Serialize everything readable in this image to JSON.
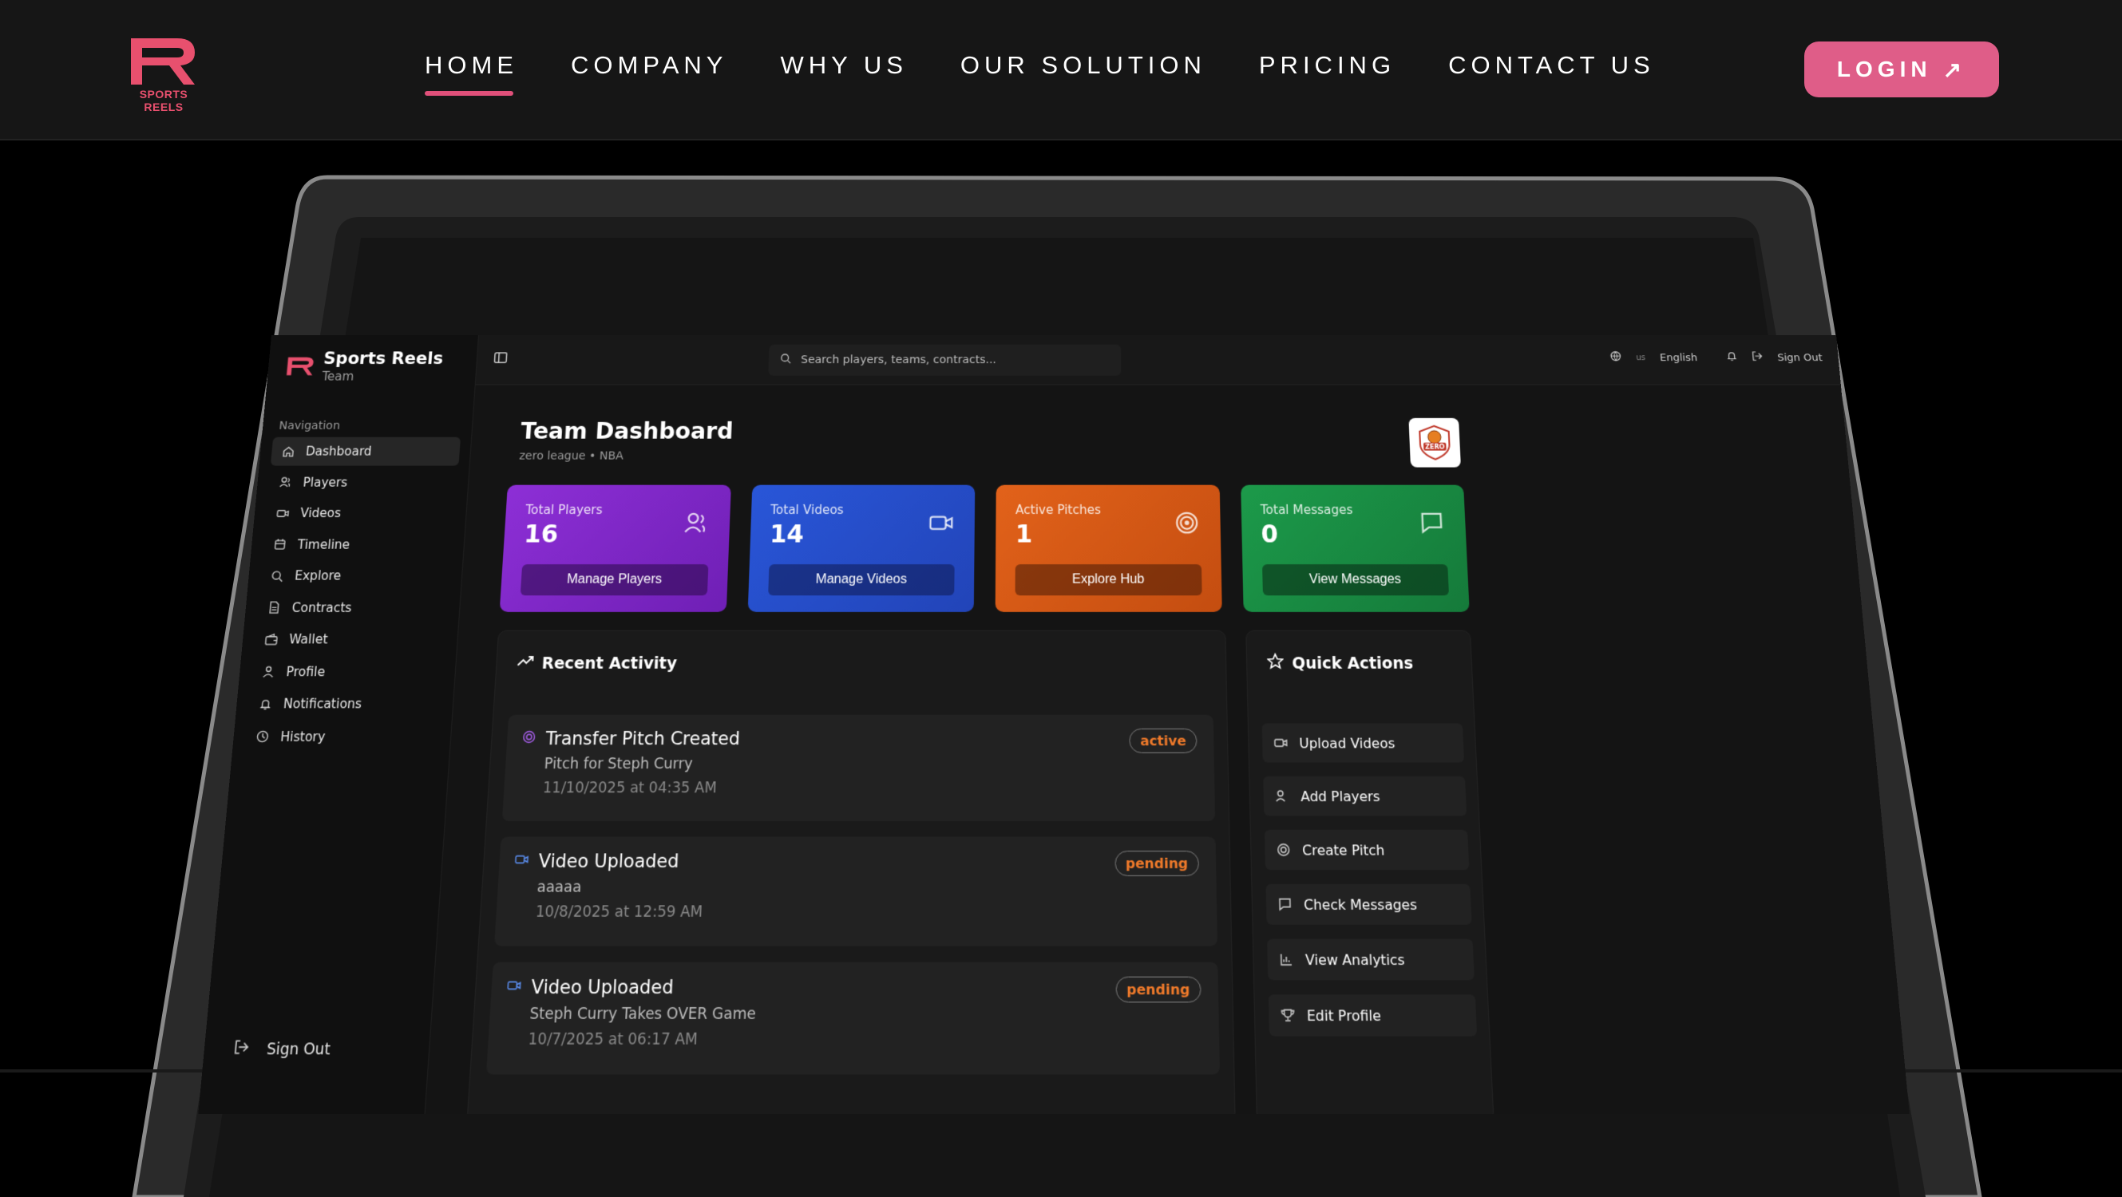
{
  "brand": {
    "name": "SPORTS REELS",
    "color": "#e8506e"
  },
  "nav": {
    "items": [
      {
        "label": "HOME",
        "active": true
      },
      {
        "label": "COMPANY",
        "active": false
      },
      {
        "label": "WHY US",
        "active": false
      },
      {
        "label": "OUR SOLUTION",
        "active": false
      },
      {
        "label": "PRICING",
        "active": false
      },
      {
        "label": "CONTACT US",
        "active": false
      }
    ],
    "login_label": "LOGIN",
    "login_icon": "arrow-up-right-icon",
    "accent": "#df5d88"
  },
  "dashboard": {
    "sidebar": {
      "brand_title": "Sports Reels",
      "brand_sub": "Team",
      "section": "Navigation",
      "items": [
        {
          "label": "Dashboard",
          "icon": "home-icon",
          "active": true
        },
        {
          "label": "Players",
          "icon": "users-icon"
        },
        {
          "label": "Videos",
          "icon": "video-icon"
        },
        {
          "label": "Timeline",
          "icon": "calendar-icon"
        },
        {
          "label": "Explore",
          "icon": "search-icon"
        },
        {
          "label": "Contracts",
          "icon": "document-icon"
        },
        {
          "label": "Wallet",
          "icon": "wallet-icon"
        },
        {
          "label": "Profile",
          "icon": "user-icon"
        },
        {
          "label": "Notifications",
          "icon": "bell-icon"
        },
        {
          "label": "History",
          "icon": "clock-icon"
        }
      ],
      "signout": "Sign Out"
    },
    "topbar": {
      "search_placeholder": "Search players, teams, contracts...",
      "lang_code": "us",
      "language": "English",
      "signout": "Sign Out"
    },
    "header": {
      "title": "Team Dashboard",
      "subtitle": "zero league • NBA",
      "team_logo_text": "ZERO"
    },
    "stats": [
      {
        "label": "Total Players",
        "value": "16",
        "button": "Manage Players",
        "icon": "users-icon",
        "color": "#8d2fd6"
      },
      {
        "label": "Total Videos",
        "value": "14",
        "button": "Manage Videos",
        "icon": "video-icon",
        "color": "#2956d8"
      },
      {
        "label": "Active Pitches",
        "value": "1",
        "button": "Explore Hub",
        "icon": "target-icon",
        "color": "#e2621a"
      },
      {
        "label": "Total Messages",
        "value": "0",
        "button": "View Messages",
        "icon": "message-icon",
        "color": "#1c9a4a"
      }
    ],
    "activity": {
      "title": "Recent Activity",
      "items": [
        {
          "title": "Transfer Pitch Created",
          "desc": "Pitch for Steph Curry",
          "date": "11/10/2025 at 04:35 AM",
          "status": "active",
          "icon": "target-icon"
        },
        {
          "title": "Video Uploaded",
          "desc": "aaaaa",
          "date": "10/8/2025 at 12:59 AM",
          "status": "pending",
          "icon": "video-icon"
        },
        {
          "title": "Video Uploaded",
          "desc": "Steph Curry Takes OVER Game",
          "date": "10/7/2025 at 06:17 AM",
          "status": "pending",
          "icon": "video-icon"
        }
      ]
    },
    "quick_actions": {
      "title": "Quick Actions",
      "items": [
        {
          "label": "Upload Videos",
          "icon": "video-icon"
        },
        {
          "label": "Add Players",
          "icon": "users-icon"
        },
        {
          "label": "Create Pitch",
          "icon": "target-icon"
        },
        {
          "label": "Check Messages",
          "icon": "message-icon"
        },
        {
          "label": "View Analytics",
          "icon": "bar-chart-icon"
        },
        {
          "label": "Edit Profile",
          "icon": "trophy-icon"
        }
      ]
    }
  }
}
